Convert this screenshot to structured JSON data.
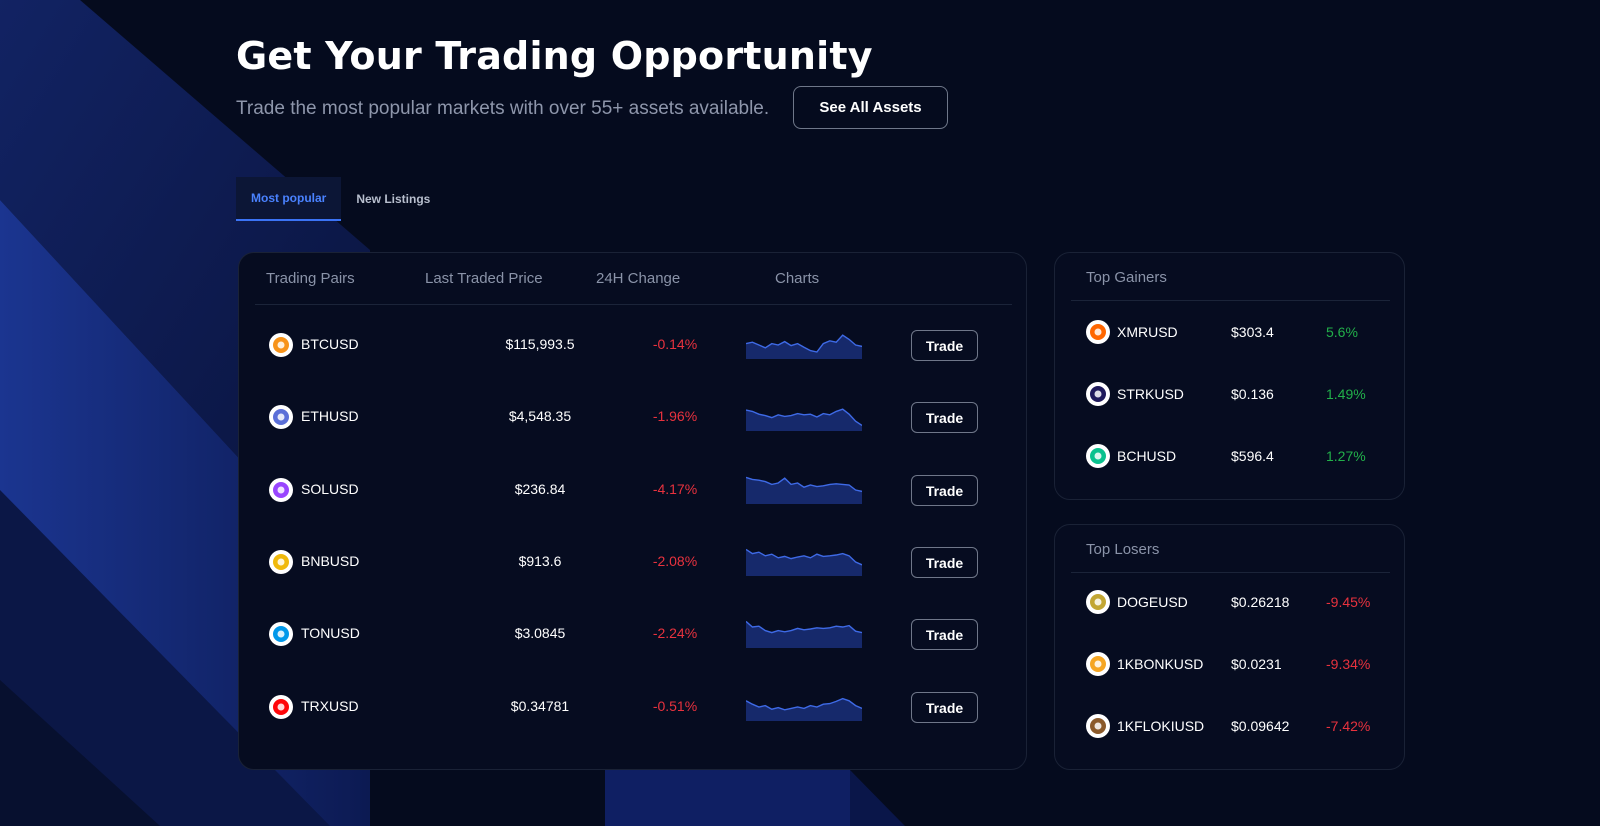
{
  "hero": {
    "title": "Get Your Trading Opportunity",
    "subtitle": "Trade the most popular markets with over 55+ assets available.",
    "see_all_label": "See All Assets"
  },
  "tabs": [
    {
      "label": "Most popular",
      "active": true
    },
    {
      "label": "New Listings",
      "active": false
    }
  ],
  "table": {
    "headers": [
      "Trading Pairs",
      "Last Traded Price",
      "24H Change",
      "Charts"
    ],
    "trade_label": "Trade",
    "rows": [
      {
        "pair": "BTCUSD",
        "price": "$115,993.5",
        "change": "-0.14%",
        "icon": "bitcoin-icon",
        "icon_color": "#f7931a",
        "spark": [
          0.55,
          0.6,
          0.5,
          0.4,
          0.55,
          0.5,
          0.62,
          0.48,
          0.55,
          0.42,
          0.3,
          0.25,
          0.55,
          0.65,
          0.6,
          0.85,
          0.7,
          0.5,
          0.45
        ]
      },
      {
        "pair": "ETHUSD",
        "price": "$4,548.35",
        "change": "-1.96%",
        "icon": "ethereum-icon",
        "icon_color": "#5b6fd8",
        "spark": [
          0.75,
          0.7,
          0.6,
          0.55,
          0.48,
          0.58,
          0.52,
          0.55,
          0.62,
          0.58,
          0.6,
          0.5,
          0.62,
          0.58,
          0.7,
          0.78,
          0.6,
          0.35,
          0.2
        ]
      },
      {
        "pair": "SOLUSD",
        "price": "$236.84",
        "change": "-4.17%",
        "icon": "solana-icon",
        "icon_color": "#9945ff",
        "spark": [
          0.95,
          0.88,
          0.85,
          0.8,
          0.7,
          0.75,
          0.92,
          0.7,
          0.75,
          0.6,
          0.68,
          0.62,
          0.65,
          0.7,
          0.72,
          0.7,
          0.68,
          0.5,
          0.45
        ]
      },
      {
        "pair": "BNBUSD",
        "price": "$913.6",
        "change": "-2.08%",
        "icon": "bnb-icon",
        "icon_color": "#f0b90b",
        "spark": [
          0.95,
          0.8,
          0.85,
          0.72,
          0.78,
          0.65,
          0.7,
          0.62,
          0.68,
          0.72,
          0.65,
          0.78,
          0.7,
          0.72,
          0.75,
          0.8,
          0.72,
          0.5,
          0.4
        ]
      },
      {
        "pair": "TONUSD",
        "price": "$3.0845",
        "change": "-2.24%",
        "icon": "toncoin-icon",
        "icon_color": "#0098ea",
        "spark": [
          0.95,
          0.75,
          0.78,
          0.62,
          0.55,
          0.62,
          0.58,
          0.62,
          0.7,
          0.65,
          0.68,
          0.72,
          0.7,
          0.72,
          0.78,
          0.75,
          0.8,
          0.6,
          0.55
        ]
      },
      {
        "pair": "TRXUSD",
        "price": "$0.34781",
        "change": "-0.51%",
        "icon": "tron-icon",
        "icon_color": "#ff060a",
        "spark": [
          0.72,
          0.6,
          0.5,
          0.55,
          0.42,
          0.48,
          0.4,
          0.45,
          0.5,
          0.45,
          0.55,
          0.5,
          0.6,
          0.62,
          0.7,
          0.8,
          0.72,
          0.55,
          0.45
        ]
      }
    ]
  },
  "gainers": {
    "title": "Top Gainers",
    "rows": [
      {
        "pair": "XMRUSD",
        "price": "$303.4",
        "change": "5.6%",
        "icon": "monero-icon",
        "icon_color": "#ff6600"
      },
      {
        "pair": "STRKUSD",
        "price": "$0.136",
        "change": "1.49%",
        "icon": "starknet-icon",
        "icon_color": "#1f1a5c"
      },
      {
        "pair": "BCHUSD",
        "price": "$596.4",
        "change": "1.27%",
        "icon": "bitcoin-cash-icon",
        "icon_color": "#0ac18e"
      }
    ]
  },
  "losers": {
    "title": "Top Losers",
    "rows": [
      {
        "pair": "DOGEUSD",
        "price": "$0.26218",
        "change": "-9.45%",
        "icon": "dogecoin-icon",
        "icon_color": "#c2a633"
      },
      {
        "pair": "1KBONKUSD",
        "price": "$0.0231",
        "change": "-9.34%",
        "icon": "bonk-icon",
        "icon_color": "#f5a623"
      },
      {
        "pair": "1KFLOKIUSD",
        "price": "$0.09642",
        "change": "-7.42%",
        "icon": "floki-icon",
        "icon_color": "#8b5a2b"
      }
    ]
  }
}
